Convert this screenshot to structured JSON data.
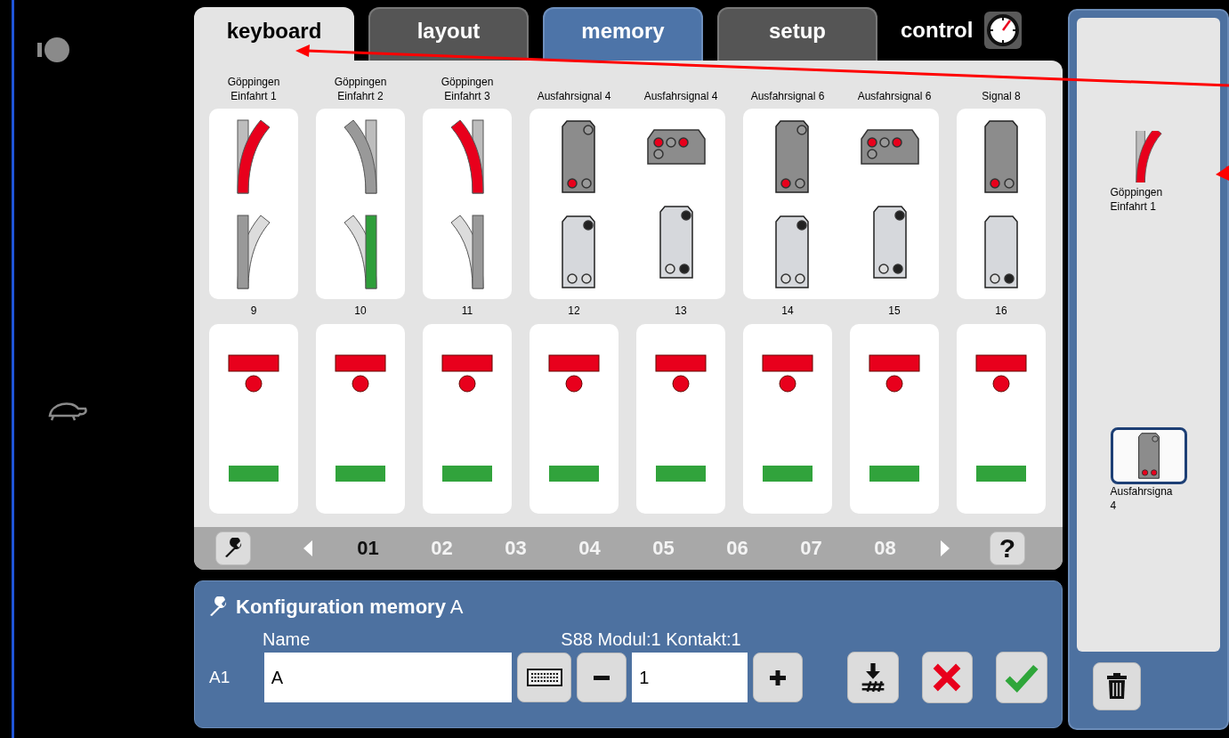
{
  "tabs": [
    {
      "label": "keyboard",
      "selected": true,
      "kind": "tab"
    },
    {
      "label": "layout",
      "selected": false,
      "kind": "tab"
    },
    {
      "label": "memory",
      "selected": false,
      "kind": "mode"
    },
    {
      "label": "setup",
      "selected": false,
      "kind": "tab"
    },
    {
      "label": "control",
      "selected": false,
      "kind": "gauge"
    }
  ],
  "top_groups": [
    {
      "items": [
        {
          "label_lines": [
            "Göppingen",
            "Einfahrt 1"
          ],
          "top": {
            "kind": "turnout-right",
            "thrown": true,
            "lit": true
          },
          "bottom": {
            "kind": "turnout-right",
            "thrown": false,
            "lit": false
          }
        }
      ]
    },
    {
      "items": [
        {
          "label_lines": [
            "Göppingen",
            "Einfahrt 2"
          ],
          "top": {
            "kind": "turnout-left",
            "thrown": true,
            "lit": false
          },
          "bottom": {
            "kind": "turnout-left",
            "thrown": false,
            "lit": true
          }
        }
      ]
    },
    {
      "items": [
        {
          "label_lines": [
            "Göppingen",
            "Einfahrt 3"
          ],
          "top": {
            "kind": "turnout-left",
            "thrown": true,
            "lit": true
          },
          "bottom": {
            "kind": "turnout-left",
            "thrown": false,
            "lit": false
          }
        }
      ]
    },
    {
      "items": [
        {
          "label_lines": [
            "Ausfahrsignal 4"
          ],
          "top": {
            "kind": "tall-signal",
            "dark": true,
            "lights": [
              {
                "on": false
              },
              {
                "on": true
              },
              {
                "on": false
              }
            ]
          },
          "bottom": {
            "kind": "tall-signal",
            "dark": false,
            "lights": [
              {
                "on": true
              },
              {
                "on": false
              },
              {
                "on": false
              }
            ]
          }
        },
        {
          "label_lines": [
            "Ausfahrsignal 4"
          ],
          "top": {
            "kind": "wide-signal",
            "dark": true,
            "lights": [
              {
                "on": true
              },
              {
                "on": false
              },
              {
                "on": true
              },
              {
                "on": false
              }
            ]
          },
          "bottom": {
            "kind": "tall-signal",
            "dark": false,
            "lights": [
              {
                "on": true
              },
              {
                "on": false
              },
              {
                "on": true
              }
            ]
          }
        }
      ]
    },
    {
      "items": [
        {
          "label_lines": [
            "Ausfahrsignal 6"
          ],
          "top": {
            "kind": "tall-signal",
            "dark": true,
            "lights": [
              {
                "on": false
              },
              {
                "on": true
              },
              {
                "on": false
              }
            ]
          },
          "bottom": {
            "kind": "tall-signal",
            "dark": false,
            "lights": [
              {
                "on": true
              },
              {
                "on": false
              },
              {
                "on": false
              }
            ]
          }
        },
        {
          "label_lines": [
            "Ausfahrsignal 6"
          ],
          "top": {
            "kind": "wide-signal",
            "dark": true,
            "lights": [
              {
                "on": true
              },
              {
                "on": false
              },
              {
                "on": true
              },
              {
                "on": false
              }
            ]
          },
          "bottom": {
            "kind": "tall-signal",
            "dark": false,
            "lights": [
              {
                "on": true
              },
              {
                "on": false
              },
              {
                "on": true
              }
            ]
          }
        }
      ]
    },
    {
      "items": [
        {
          "label_lines": [
            "Signal 8"
          ],
          "top": {
            "kind": "tall-signal",
            "dark": true,
            "lights": [
              {
                "on": true
              },
              {
                "on": false
              }
            ]
          },
          "bottom": {
            "kind": "tall-signal",
            "dark": false,
            "lights": [
              {
                "on": false
              },
              {
                "on": true
              }
            ]
          }
        }
      ]
    }
  ],
  "slots": [
    {
      "number": "9"
    },
    {
      "number": "10"
    },
    {
      "number": "11"
    },
    {
      "number": "12"
    },
    {
      "number": "13"
    },
    {
      "number": "14"
    },
    {
      "number": "15"
    },
    {
      "number": "16"
    }
  ],
  "pages": [
    {
      "label": "01",
      "selected": true
    },
    {
      "label": "02",
      "selected": false
    },
    {
      "label": "03",
      "selected": false
    },
    {
      "label": "04",
      "selected": false
    },
    {
      "label": "05",
      "selected": false
    },
    {
      "label": "06",
      "selected": false
    },
    {
      "label": "07",
      "selected": false
    },
    {
      "label": "08",
      "selected": false
    }
  ],
  "help_button": "?",
  "config": {
    "title": "**Konfiguration memory** A",
    "name_label": "Name",
    "contact_label": "S88 Modul:1 Kontakt:1",
    "row_label": "A1",
    "name_value": "A",
    "contact_value": "1"
  },
  "sequence": [
    {
      "label_lines": [
        "Göppingen",
        "Einfahrt 1"
      ],
      "selected": false,
      "icon": {
        "kind": "turnout-right",
        "thrown": true,
        "lit": true
      }
    },
    {
      "label_lines": [
        "Ausfahrsigna",
        "4"
      ],
      "selected": true,
      "icon": {
        "kind": "tall-signal",
        "dark": true,
        "lights": [
          {
            "on": false
          },
          {
            "on": true
          },
          {
            "on": true
          }
        ]
      }
    }
  ]
}
